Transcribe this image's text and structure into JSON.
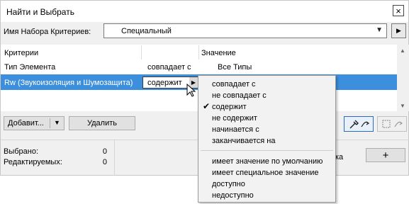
{
  "window": {
    "title": "Найти и Выбрать",
    "close_glyph": "×"
  },
  "criteria_set": {
    "label": "Имя Набора Критериев:",
    "value": "Специальный",
    "arrow_glyph": "▼",
    "next_glyph": "▶"
  },
  "table": {
    "headers": [
      "Критерии",
      "Значение"
    ],
    "rows": [
      {
        "criterion": "Тип Элемента",
        "operator": "совпадает с",
        "value": "Все Типы"
      },
      {
        "criterion": "Rw (Звукоизоляция и Шумозащита)",
        "operator": "содержит",
        "value": ""
      }
    ],
    "op_arrow_glyph": "▶",
    "scroll_up_glyph": "▲",
    "scroll_down_glyph": "▼"
  },
  "buttons": {
    "add_label": "Добавит...",
    "add_arrow_glyph": "▼",
    "delete_label": "Удалить",
    "plus_label": "+"
  },
  "stats": {
    "selected_label": "Выбрано:",
    "selected_value": "0",
    "editable_label": "Редактируемых:",
    "editable_value": "0",
    "partial_text": "ка"
  },
  "menu": {
    "check_glyph": "✔",
    "items": [
      "совпадает с",
      "не совпадает с",
      "содержит",
      "не содержит",
      "начинается с",
      "заканчивается на",
      "имеет значение по умолчанию",
      "имеет специальное значение",
      "доступно",
      "недоступно"
    ]
  },
  "colors": {
    "selection": "#3c8fdc",
    "accent": "#2a6cc0"
  }
}
